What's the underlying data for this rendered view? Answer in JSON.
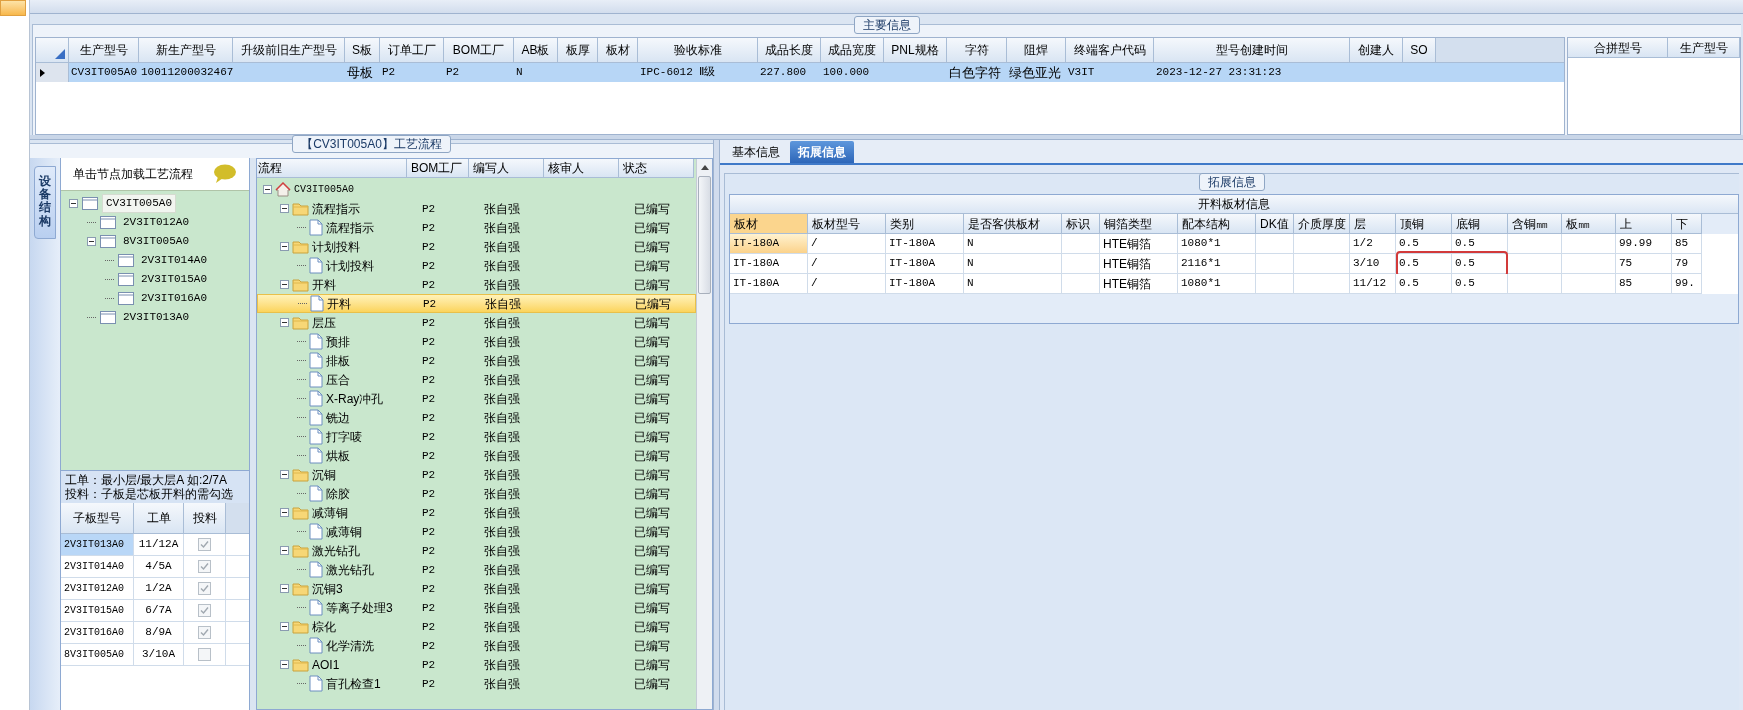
{
  "main_info": {
    "title": "主要信息",
    "columns": [
      "生产型号",
      "新生产型号",
      "升级前旧生产型号",
      "S板",
      "订单工厂",
      "BOM工厂",
      "AB板",
      "板厚",
      "板材",
      "验收标准",
      "成品长度",
      "成品宽度",
      "PNL规格",
      "字符",
      "阻焊",
      "终端客户代码",
      "型号创建时间",
      "创建人",
      "SO"
    ],
    "rows": [
      {
        "selected": true,
        "cells": [
          "CV3IT005A0",
          "10011200032467",
          null,
          "母板",
          "P2",
          "P2",
          "N",
          null,
          null,
          "IPC-6012 Ⅱ级",
          "227.800",
          "100.000",
          null,
          "白色字符",
          "绿色亚光",
          "V3IT",
          "2023-12-27 23:31:23",
          null,
          null
        ]
      }
    ],
    "merge_columns": [
      "合拼型号",
      "生产型号"
    ]
  },
  "process": {
    "title": "【CV3IT005A0】工艺流程",
    "side_tab": "设备结构",
    "hint": "单击节点加载工艺流程",
    "device_tree": [
      {
        "name": "CV3IT005A0",
        "selected": true,
        "children": [
          {
            "name": "2V3IT012A0",
            "selected": false
          },
          {
            "name": "8V3IT005A0",
            "selected": false,
            "children": [
              {
                "name": "2V3IT014A0",
                "selected": false
              },
              {
                "name": "2V3IT015A0",
                "selected": false
              },
              {
                "name": "2V3IT016A0",
                "selected": false
              }
            ]
          },
          {
            "name": "2V3IT013A0",
            "selected": false
          }
        ]
      }
    ],
    "notes": [
      "工单：最小层/最大层A 如:2/7A",
      "投料：子板是芯板开料的需勾选"
    ],
    "sub_columns": [
      "子板型号",
      "工单",
      "投料"
    ],
    "sub_rows": [
      {
        "model": "2V3IT013A0",
        "order": "11/12A",
        "feed": true,
        "selected": true
      },
      {
        "model": "2V3IT014A0",
        "order": "4/5A",
        "feed": true,
        "selected": false
      },
      {
        "model": "2V3IT012A0",
        "order": "1/2A",
        "feed": true,
        "selected": false
      },
      {
        "model": "2V3IT015A0",
        "order": "6/7A",
        "feed": true,
        "selected": false
      },
      {
        "model": "2V3IT016A0",
        "order": "8/9A",
        "feed": true,
        "selected": false
      },
      {
        "model": "8V3IT005A0",
        "order": "3/10A",
        "feed": false,
        "selected": false
      }
    ],
    "flow_columns": [
      "流程",
      "BOM工厂",
      "编写人",
      "核审人",
      "状态"
    ],
    "flow_tree": [
      {
        "name": "CV3IT005A0",
        "kind": "home",
        "selected": false,
        "children": [
          {
            "name": "流程指示",
            "kind": "folder",
            "bom": "P2",
            "writer": "张自强",
            "status": "已编写",
            "selected": false,
            "children": [
              {
                "name": "流程指示",
                "kind": "document",
                "bom": "P2",
                "writer": "张自强",
                "status": "已编写",
                "selected": false
              }
            ]
          },
          {
            "name": "计划投料",
            "kind": "folder",
            "bom": "P2",
            "writer": "张自强",
            "status": "已编写",
            "selected": false,
            "children": [
              {
                "name": "计划投料",
                "kind": "document",
                "bom": "P2",
                "writer": "张自强",
                "status": "已编写",
                "selected": false
              }
            ]
          },
          {
            "name": "开料",
            "kind": "folder",
            "bom": "P2",
            "writer": "张自强",
            "status": "已编写",
            "selected": false,
            "children": [
              {
                "name": "开料",
                "kind": "document",
                "bom": "P2",
                "writer": "张自强",
                "status": "已编写",
                "selected": true
              }
            ]
          },
          {
            "name": "层压",
            "kind": "folder",
            "bom": "P2",
            "writer": "张自强",
            "status": "已编写",
            "selected": false,
            "children": [
              {
                "name": "预排",
                "kind": "document",
                "bom": "P2",
                "writer": "张自强",
                "status": "已编写",
                "selected": false
              },
              {
                "name": "排板",
                "kind": "document",
                "bom": "P2",
                "writer": "张自强",
                "status": "已编写",
                "selected": false
              },
              {
                "name": "压合",
                "kind": "document",
                "bom": "P2",
                "writer": "张自强",
                "status": "已编写",
                "selected": false
              },
              {
                "name": "X-Ray冲孔",
                "kind": "document",
                "bom": "P2",
                "writer": "张自强",
                "status": "已编写",
                "selected": false
              },
              {
                "name": "铣边",
                "kind": "document",
                "bom": "P2",
                "writer": "张自强",
                "status": "已编写",
                "selected": false
              },
              {
                "name": "打字唛",
                "kind": "document",
                "bom": "P2",
                "writer": "张自强",
                "status": "已编写",
                "selected": false
              },
              {
                "name": "烘板",
                "kind": "document",
                "bom": "P2",
                "writer": "张自强",
                "status": "已编写",
                "selected": false
              }
            ]
          },
          {
            "name": "沉铜",
            "kind": "folder",
            "bom": "P2",
            "writer": "张自强",
            "status": "已编写",
            "selected": false,
            "children": [
              {
                "name": "除胶",
                "kind": "document",
                "bom": "P2",
                "writer": "张自强",
                "status": "已编写",
                "selected": false
              }
            ]
          },
          {
            "name": "减薄铜",
            "kind": "folder",
            "bom": "P2",
            "writer": "张自强",
            "status": "已编写",
            "selected": false,
            "children": [
              {
                "name": "减薄铜",
                "kind": "document",
                "bom": "P2",
                "writer": "张自强",
                "status": "已编写",
                "selected": false
              }
            ]
          },
          {
            "name": "激光钻孔",
            "kind": "folder",
            "bom": "P2",
            "writer": "张自强",
            "status": "已编写",
            "selected": false,
            "children": [
              {
                "name": "激光钻孔",
                "kind": "document",
                "bom": "P2",
                "writer": "张自强",
                "status": "已编写",
                "selected": false
              }
            ]
          },
          {
            "name": "沉铜3",
            "kind": "folder",
            "bom": "P2",
            "writer": "张自强",
            "status": "已编写",
            "selected": false,
            "children": [
              {
                "name": "等离子处理3",
                "kind": "document",
                "bom": "P2",
                "writer": "张自强",
                "status": "已编写",
                "selected": false
              }
            ]
          },
          {
            "name": "棕化",
            "kind": "folder",
            "bom": "P2",
            "writer": "张自强",
            "status": "已编写",
            "selected": false,
            "children": [
              {
                "name": "化学清洗",
                "kind": "document",
                "bom": "P2",
                "writer": "张自强",
                "status": "已编写",
                "selected": false
              }
            ]
          },
          {
            "name": "AOI1",
            "kind": "folder",
            "bom": "P2",
            "writer": "张自强",
            "status": "已编写",
            "selected": false,
            "children": [
              {
                "name": "盲孔检查1",
                "kind": "document",
                "bom": "P2",
                "writer": "张自强",
                "status": "已编写",
                "selected": false
              }
            ]
          }
        ]
      }
    ]
  },
  "detail": {
    "tabs": [
      {
        "label": "基本信息",
        "selected": false
      },
      {
        "label": "拓展信息",
        "selected": true
      }
    ],
    "group_title": "拓展信息",
    "table_title": "开料板材信息",
    "columns": [
      "板材",
      "板材型号",
      "类别",
      "是否客供板材",
      "标识",
      "铜箔类型",
      "配本结构",
      "DK值",
      "介质厚度",
      "层",
      "顶铜",
      "底铜",
      "含铜㎜",
      "板㎜",
      "上",
      "下"
    ],
    "rows": [
      {
        "selected": true,
        "marked": false,
        "cells": [
          "IT-180A",
          "/",
          "IT-180A",
          "N",
          null,
          "HTE铜箔",
          "1080*1",
          null,
          null,
          "1/2",
          "0.5",
          "0.5",
          null,
          null,
          "99.99",
          "85"
        ]
      },
      {
        "selected": false,
        "marked": true,
        "cells": [
          "IT-180A",
          "/",
          "IT-180A",
          "N",
          null,
          "HTE铜箔",
          "2116*1",
          null,
          null,
          "3/10",
          "0.5",
          "0.5",
          null,
          null,
          "75",
          "79"
        ]
      },
      {
        "selected": false,
        "marked": false,
        "cells": [
          "IT-180A",
          "/",
          "IT-180A",
          "N",
          null,
          "HTE铜箔",
          "1080*1",
          null,
          null,
          "11/12",
          "0.5",
          "0.5",
          null,
          null,
          "85",
          "99."
        ]
      }
    ]
  }
}
